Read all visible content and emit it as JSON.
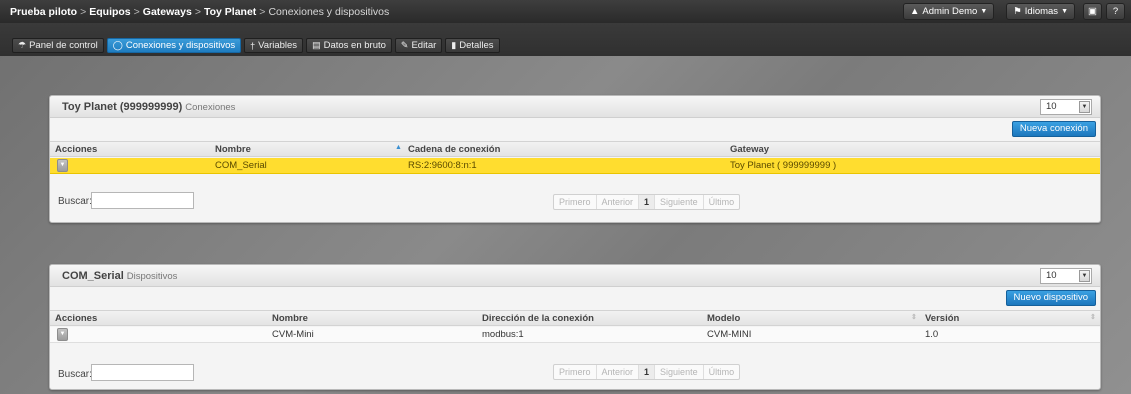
{
  "breadcrumb": {
    "items": [
      "Prueba piloto",
      "Equipos",
      "Gateways",
      "Toy Planet"
    ],
    "current": "Conexiones y dispositivos",
    "separator": ">"
  },
  "topbar": {
    "user_label": "Admin Demo",
    "lang_label": "Idiomas",
    "screen_icon": "screen-icon",
    "help_label": "?"
  },
  "tabs": [
    {
      "label": "Panel de control",
      "icon": "dashboard-icon"
    },
    {
      "label": "Conexiones y dispositivos",
      "icon": "connection-icon",
      "active": true
    },
    {
      "label": "Variables",
      "icon": "variables-icon"
    },
    {
      "label": "Datos en bruto",
      "icon": "table-icon"
    },
    {
      "label": "Editar",
      "icon": "pencil-icon"
    },
    {
      "label": "Detalles",
      "icon": "details-icon"
    }
  ],
  "connections_panel": {
    "title": "Toy Planet (999999999)",
    "subtitle": "Conexiones",
    "page_size": "10",
    "new_button": "Nueva conexión",
    "columns": [
      "Acciones",
      "Nombre",
      "Cadena de conexión",
      "Gateway"
    ],
    "rows": [
      {
        "nombre": "COM_Serial",
        "cadena": "RS:2:9600:8:n:1",
        "gateway": "Toy Planet ( 999999999 )"
      }
    ],
    "search_label": "Buscar:",
    "search_value": "",
    "pager": [
      "Primero",
      "Anterior",
      "1",
      "Siguiente",
      "Último"
    ]
  },
  "devices_panel": {
    "title": "COM_Serial",
    "subtitle": "Dispositivos",
    "page_size": "10",
    "new_button": "Nuevo dispositivo",
    "columns": [
      "Acciones",
      "Nombre",
      "Dirección de la conexión",
      "Modelo",
      "Versión"
    ],
    "rows": [
      {
        "nombre": "CVM-Mini",
        "direccion": "modbus:1",
        "modelo": "CVM-MINI",
        "version": "1.0"
      }
    ],
    "search_label": "Buscar:",
    "search_value": "",
    "pager": [
      "Primero",
      "Anterior",
      "1",
      "Siguiente",
      "Último"
    ]
  },
  "colors": {
    "accent": "#1f7dc0",
    "selected_row": "#ffdd2f"
  }
}
